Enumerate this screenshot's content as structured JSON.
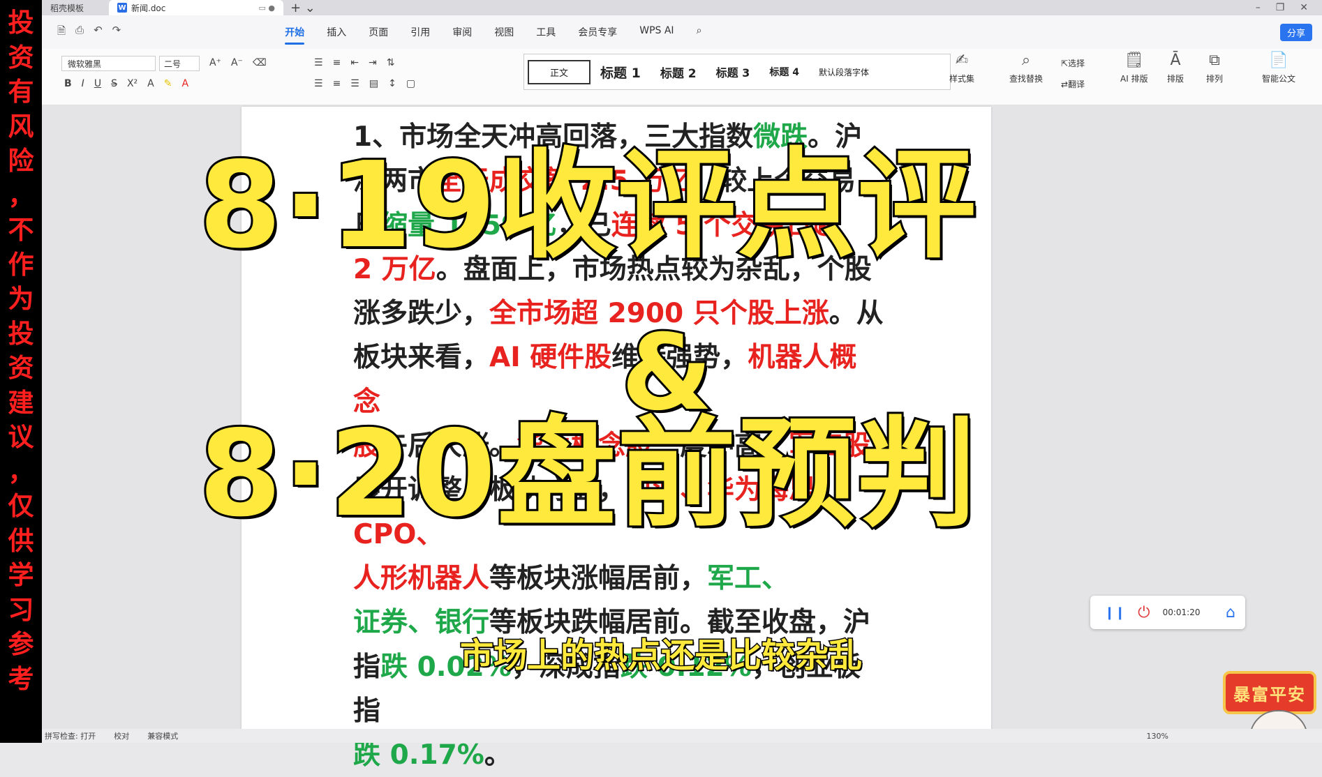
{
  "left_banner": {
    "chars": [
      "投",
      "资",
      "有",
      "风",
      "险",
      "，",
      "不",
      "作",
      "为",
      "投",
      "资",
      "建",
      "议",
      "，",
      "仅",
      "供",
      "学",
      "习",
      "参",
      "考"
    ]
  },
  "tabs": [
    {
      "label": "稻壳模板"
    },
    {
      "label": "新闻.doc"
    }
  ],
  "menu": {
    "items": [
      "开始",
      "插入",
      "页面",
      "引用",
      "审阅",
      "视图",
      "工具",
      "会员专享",
      "WPS AI"
    ],
    "active": "开始",
    "share_label": "分享"
  },
  "ribbon": {
    "font_name": "微软雅黑",
    "font_size": "二号",
    "styles": [
      "正文",
      "标题 1",
      "标题 2",
      "标题 3",
      "标题 4",
      "默认段落字体"
    ],
    "style_set_label": "样式集",
    "find_replace_label": "查找替换",
    "select_label": "选择",
    "translate_label": "翻译",
    "ai_layout_label": "AI 排版",
    "layout_label": "排版",
    "arrange_label": "排列",
    "smart_doc_label": "智能公文"
  },
  "document": {
    "line1_prefix": "1、市场全天冲高回落，三大指数",
    "line1_green": "微跌",
    "line1_suffix": "。沪",
    "line2_a": "深两市",
    "line2_b": "全天成交额 2.5 万亿",
    "line2_c": "，较上个交易",
    "line3_a": "日",
    "line3_green": "缩量 1759 亿",
    "line3_b": "，已",
    "line3_red": "连续 5 个交易日超",
    "line4_red": "2 万亿",
    "line4_b": "。盘面上，市场热点较为杂乱，个股",
    "line5_a": "涨多跌少，",
    "line5_red": "全市场超 2900 只个股上涨",
    "line5_b": "。从",
    "line6_a": "板块来看，",
    "line6_red1": "AI 硬件股",
    "line6_b": "维持强势，",
    "line6_red2": "机器人概念",
    "line7_red1": "股",
    "line7_a": "午后大涨。",
    "line7_red2": "华为概念股",
    "line7_b": "一度冲高。",
    "line7_red3": "军工股",
    "line8_a": "展开调整。板块方面，",
    "line8_red": "白酒、华为海思、CPO、",
    "line9_red": "人形机器人",
    "line9_a": "等板块涨幅居前，",
    "line9_green": "军工、",
    "line10_green": "证券、银行",
    "line10_a": "等板块跌幅居前。截至收盘，沪",
    "line11_a": "指",
    "line11_green1": "跌 0.02%",
    "line11_b": "，深成指",
    "line11_green2": "跌 0.12%",
    "line11_c": "，创业板指",
    "line12_green": "跌 0.17%",
    "line12_b": "。"
  },
  "overlay": {
    "line1": "8·19收评点评",
    "amp": "&",
    "line2": "8·20盘前预判"
  },
  "subtitle": "市场上的热点还是比较杂乱",
  "recorder": {
    "time": "00:01:20"
  },
  "stamp": {
    "text": "暴富平安"
  },
  "statusbar": {
    "spell_check": "拼写检查: 打开",
    "proofread": "校对",
    "compat_mode": "兼容模式",
    "zoom": "130%"
  },
  "colors": {
    "accent": "#1e6fe6",
    "red_text": "#e8231f",
    "green_text": "#1fa84a",
    "overlay_yellow": "#ffe93c"
  }
}
